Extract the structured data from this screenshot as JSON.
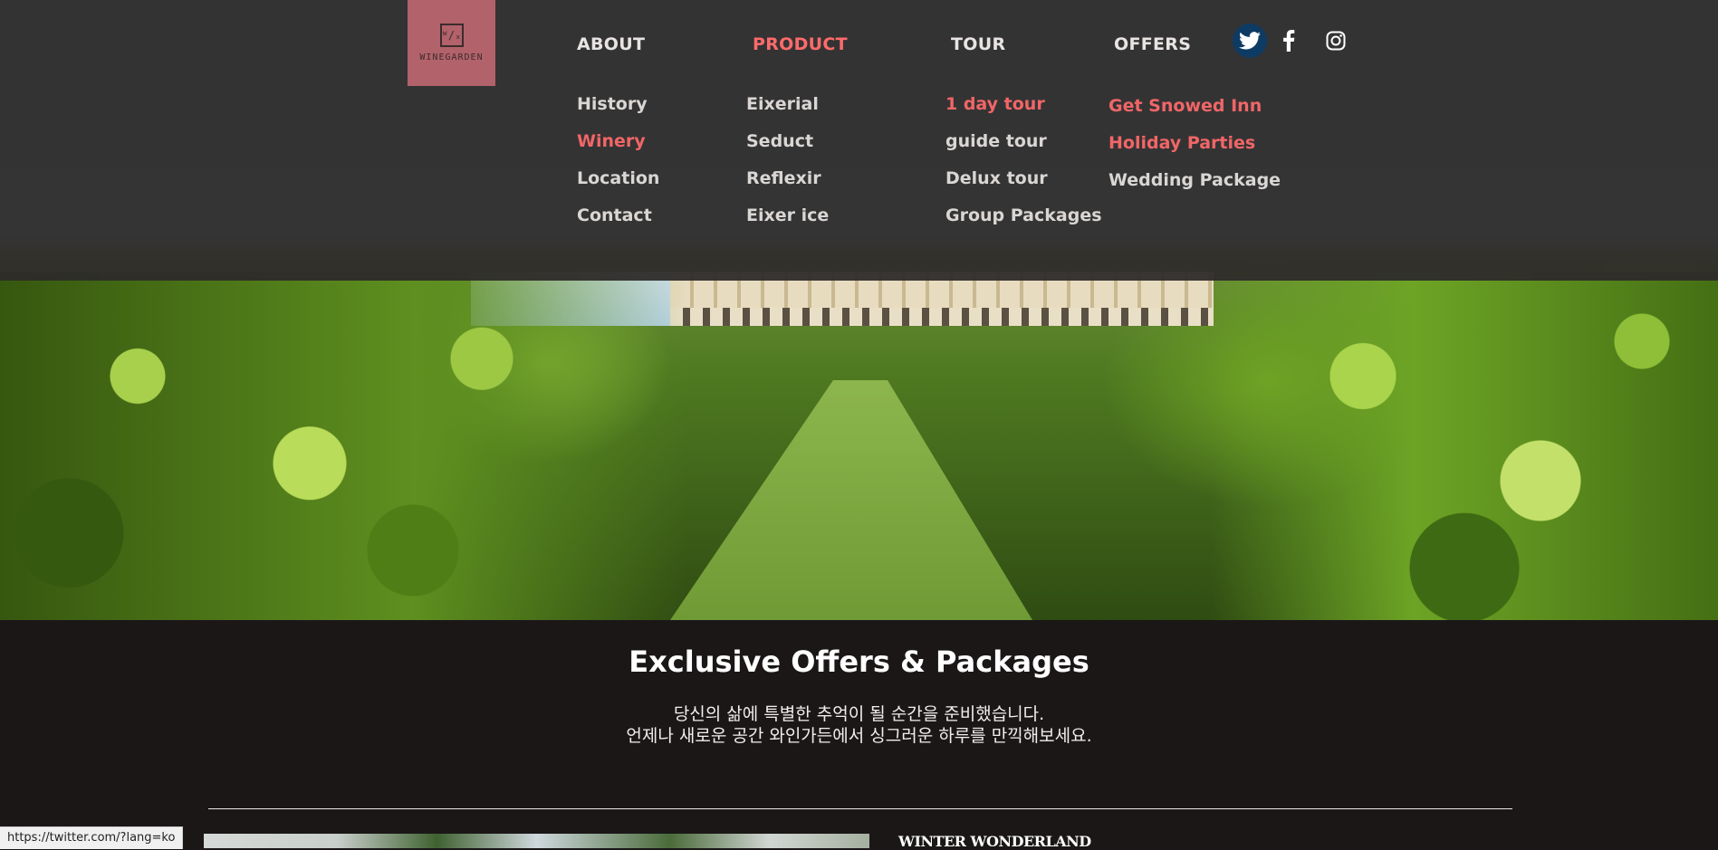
{
  "logo": {
    "text": "WINEGARDEN",
    "mark": "ᵂ/ₓ"
  },
  "nav": {
    "about": "ABOUT",
    "product": "PRODUCT",
    "tour": "TOUR",
    "offers": "OFFERS",
    "about_items": [
      "History",
      "Winery",
      "Location",
      "Contact"
    ],
    "product_items": [
      "Eixerial",
      "Seduct",
      "Reflexir",
      "Eixer ice"
    ],
    "tour_items": [
      "1 day tour",
      "guide tour",
      "Delux tour",
      "Group Packages"
    ],
    "offers_items": [
      "Get Snowed Inn",
      "Holiday Parties",
      "Wedding Package"
    ]
  },
  "social": {
    "twitter": "twitter-icon",
    "facebook": "facebook-icon",
    "instagram": "instagram-icon"
  },
  "colors": {
    "accent": "#f16667",
    "header_bg": "#2e2a29",
    "logo_bg": "#b2626a",
    "page_bg": "#1b1717"
  },
  "section": {
    "title": "Exclusive Offers & Packages",
    "line1": "당신의 삶에 특별한 추억이 될 순간을 준비했습니다.",
    "line2": "언제나 새로운 공간 와인가든에서 싱그러운 하루를 만끽해보세요."
  },
  "card": {
    "title": "WINTER WONDERLAND"
  },
  "status_bar": {
    "url": "https://twitter.com/?lang=ko"
  }
}
